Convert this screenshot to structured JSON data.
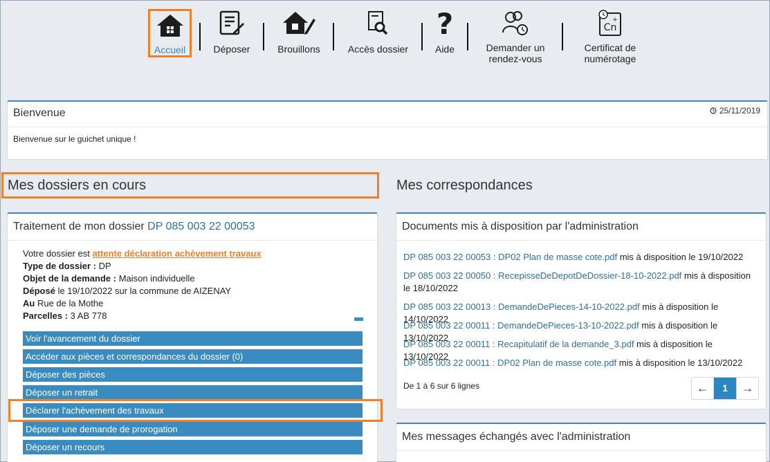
{
  "toolbar": {
    "items": [
      {
        "label": "Accueil",
        "icon": "home-icon"
      },
      {
        "label": "Déposer",
        "icon": "form-edit-icon"
      },
      {
        "label": "Brouillons",
        "icon": "home-edit-icon"
      },
      {
        "label": "Accès dossier",
        "icon": "document-search-icon"
      },
      {
        "label": "Aide",
        "icon": "question-icon"
      },
      {
        "label1": "Demander un",
        "label2": "rendez-vous",
        "icon": "appointment-icon"
      },
      {
        "label1": "Certificat de",
        "label2": "numérotage",
        "icon": "numbering-icon"
      }
    ]
  },
  "welcome": {
    "title": "Bienvenue",
    "date": "25/11/2019",
    "message": "Bienvenue sur le guichet unique !"
  },
  "dossiers": {
    "section_title": "Mes dossiers en cours",
    "panel_title_prefix": "Traitement de mon dossier ",
    "dossier_number": "DP 085 003 22 00053",
    "status_prefix": "Votre dossier est ",
    "status": "attente déclaration achèvement travaux",
    "type_label": "Type de dossier :",
    "type_value": " DP",
    "objet_label": "Objet de la demande :",
    "objet_value": " Maison individuelle",
    "depose_label": "Déposé",
    "depose_value": " le 19/10/2022 sur la commune de AIZENAY",
    "au_label": "Au",
    "au_value": " Rue de la Mothe",
    "parcelles_label": "Parcelles :",
    "parcelles_value": " 3 AB 778",
    "actions": [
      "Voir l'avancement du dossier",
      "Accéder aux pièces et correspondances du dossier (0)",
      "Déposer des pièces",
      "Déposer un retrait",
      "Déclarer l'achèvement des travaux",
      "Déposer une demande de prorogation",
      "Déposer un recours"
    ]
  },
  "correspondances": {
    "section_title": "Mes correspondances",
    "documents_title": "Documents mis à disposition par l'administration",
    "documents": [
      {
        "link": "DP 085 003 22 00053 : DP02 Plan de masse cote.pdf",
        "suffix": " mis à disposition le 19/10/2022"
      },
      {
        "link": "DP 085 003 22 00050 : RecepisseDeDepotDeDossier-18-10-2022.pdf",
        "suffix": " mis à disposition le 18/10/2022"
      },
      {
        "link": "DP 085 003 22 00013 : DemandeDePieces-14-10-2022.pdf",
        "suffix": " mis à disposition le 14/10/2022"
      },
      {
        "link": "DP 085 003 22 00011 : DemandeDePieces-13-10-2022.pdf",
        "suffix": " mis à disposition le 13/10/2022"
      },
      {
        "link": "DP 085 003 22 00011 : Recapitulatif de la demande_3.pdf",
        "suffix": " mis à disposition le 13/10/2022"
      },
      {
        "link": "DP 085 003 22 00011 : DP02 Plan de masse cote.pdf",
        "suffix": " mis à disposition le 13/10/2022"
      }
    ],
    "pagination_info": "De 1 à 6 sur 6 lignes",
    "pager": {
      "prev": "←",
      "current": "1",
      "next": "→"
    },
    "messages_title": "Mes messages échangés avec l'administration"
  },
  "colors": {
    "accent": "#3a87c4",
    "highlight": "#f07f2b",
    "button": "#3a8bbf"
  }
}
